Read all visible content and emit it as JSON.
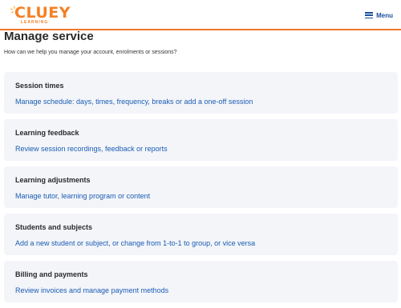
{
  "header": {
    "logo_main": "CLUEY",
    "logo_sub": "LEARNING",
    "menu_label": "Menu"
  },
  "page": {
    "title": "Manage service",
    "subtitle": "How can we help you manage your account, enrolments or sessions?"
  },
  "cards": [
    {
      "title": "Session times",
      "description": "Manage schedule: days, times, frequency, breaks or add a one-off session"
    },
    {
      "title": "Learning feedback",
      "description": "Review session recordings, feedback or reports"
    },
    {
      "title": "Learning adjustments",
      "description": "Manage tutor, learning program or content"
    },
    {
      "title": "Students and subjects",
      "description": "Add a new student or subject, or change from 1-to-1 to group, or vice versa"
    },
    {
      "title": "Billing and payments",
      "description": "Review invoices and manage payment methods"
    }
  ],
  "colors": {
    "brand_orange": "#f58024",
    "link_blue": "#1b5cb3",
    "card_bg": "#f3f5f9"
  },
  "icons": [
    "logo-spark-icon",
    "hamburger-menu-icon"
  ]
}
